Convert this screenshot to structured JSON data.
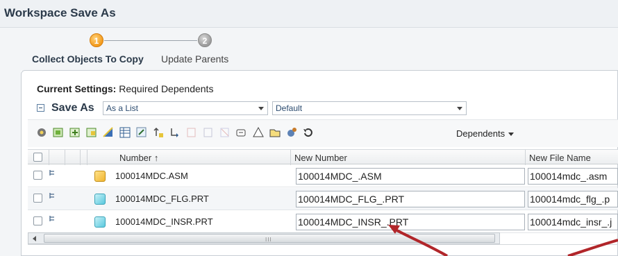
{
  "window": {
    "title": "Workspace Save As"
  },
  "wizard": {
    "steps": [
      {
        "number": "1",
        "label": "Collect Objects To Copy",
        "state": "active",
        "color": "#f39a1b"
      },
      {
        "number": "2",
        "label": "Update Parents",
        "state": "inactive",
        "color": "#9a9a9a"
      }
    ]
  },
  "settings": {
    "label": "Current Settings:",
    "value": "Required Dependents"
  },
  "saveas": {
    "label": "Save As",
    "view_select": "As a List",
    "rule_select": "Default"
  },
  "toolbar": {
    "icons": [
      "gear-icon",
      "add-objects-icon",
      "include-all-icon",
      "include-children-icon",
      "checkout-icon",
      "table-icon",
      "edit-icon",
      "set-parent-icon",
      "move-icon",
      "new-icon",
      "blank-icon",
      "exclude-icon",
      "copy-icon",
      "triangle-icon",
      "folder-icon",
      "settings-icon",
      "refresh-icon"
    ],
    "dependents_label": "Dependents"
  },
  "grid": {
    "columns": [
      "Number",
      "New Number",
      "New File Name"
    ],
    "sort_indicator": "↑",
    "rows": [
      {
        "number": "100014MDC.ASM",
        "type": "asm",
        "new_number": "100014MDC_.ASM",
        "new_file": "100014mdc_.asm"
      },
      {
        "number": "100014MDC_FLG.PRT",
        "type": "prt",
        "new_number": "100014MDC_FLG_.PRT",
        "new_file": "100014mdc_flg_.p"
      },
      {
        "number": "100014MDC_INSR.PRT",
        "type": "prt",
        "new_number": "100014MDC_INSR_.PRT",
        "new_file": "100014mdc_insr_.j"
      }
    ]
  },
  "scrollbar": {
    "grip": "III"
  },
  "colors": {
    "accent": "#f39a1b",
    "arrow": "#b1262a",
    "header_text": "#2b3a4a"
  }
}
